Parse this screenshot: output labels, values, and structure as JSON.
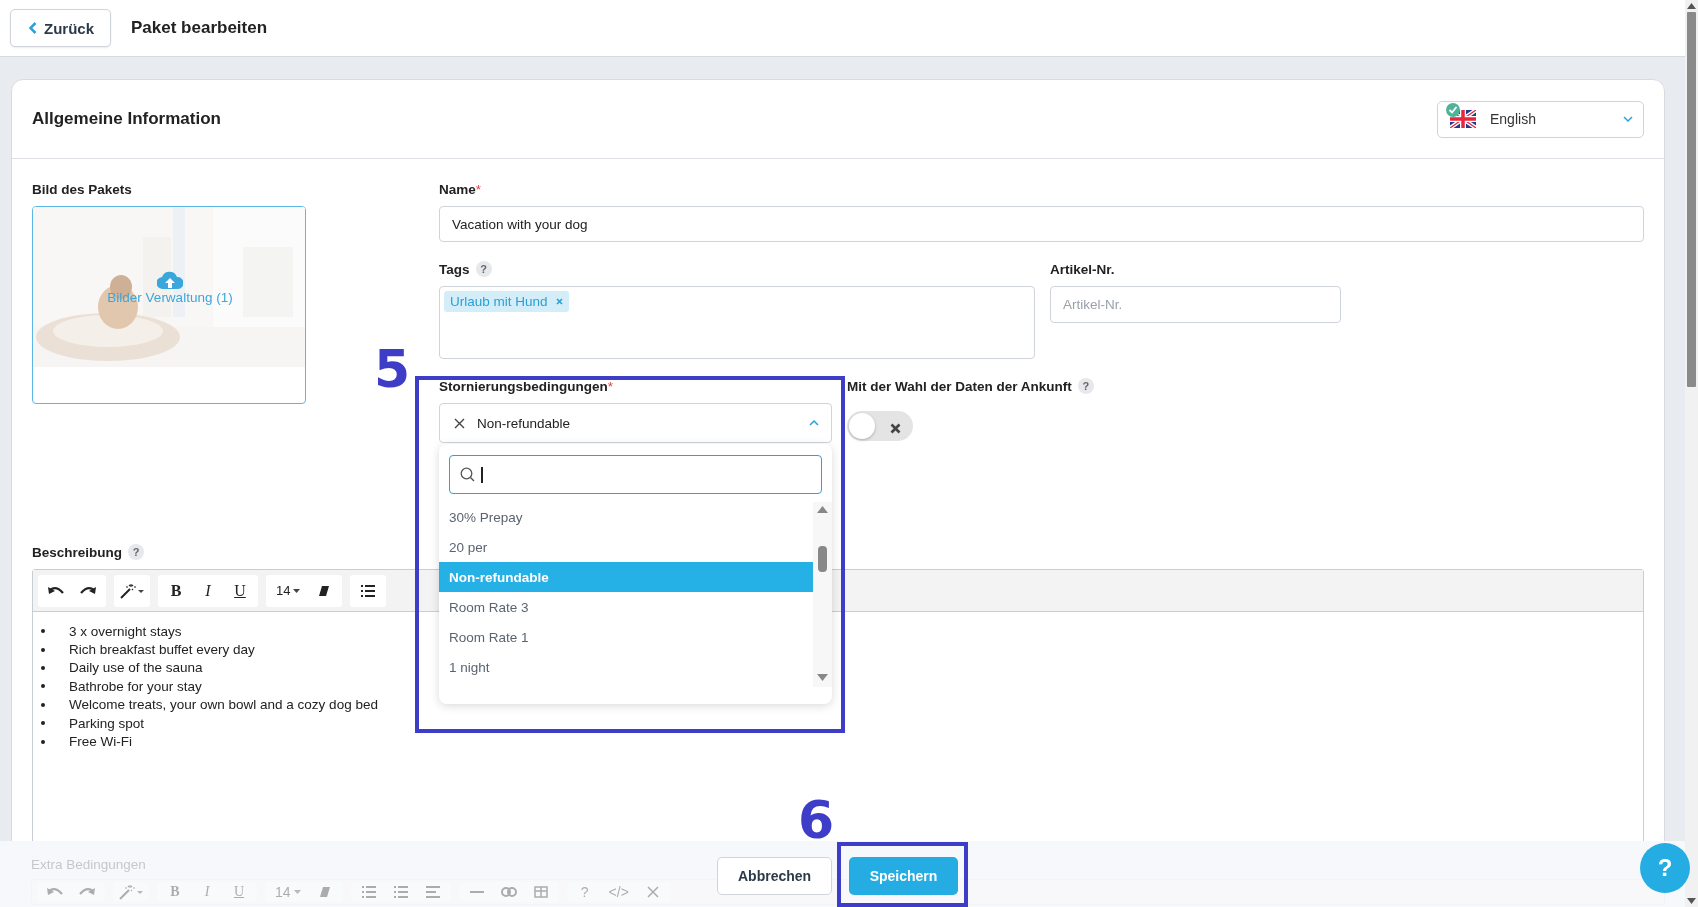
{
  "header": {
    "back_button": "Zurück",
    "title": "Paket bearbeiten"
  },
  "card": {
    "title": "Allgemeine Information",
    "language": {
      "value": "English"
    }
  },
  "image": {
    "label": "Bild des Pakets",
    "caption": "Bilder Verwaltung (1)"
  },
  "name": {
    "label": "Name",
    "required_mark": "*",
    "value": "Vacation with your dog"
  },
  "tags": {
    "label": "Tags",
    "help": "?",
    "items": [
      "Urlaub mit Hund"
    ]
  },
  "article": {
    "label": "Artikel-Nr.",
    "placeholder": "Artikel-Nr."
  },
  "cancellation": {
    "label": "Stornierungsbedingungen",
    "required_mark": "*",
    "value": "Non-refundable",
    "expanded": true,
    "options": [
      {
        "label": "30% Prepay",
        "selected": false
      },
      {
        "label": "20 per",
        "selected": false
      },
      {
        "label": "Non-refundable",
        "selected": true
      },
      {
        "label": "Room Rate 3",
        "selected": false
      },
      {
        "label": "Room Rate 1",
        "selected": false
      },
      {
        "label": "1 night",
        "selected": false
      }
    ]
  },
  "arrival_toggle": {
    "label": "Mit der Wahl der Daten der Ankunft",
    "help": "?",
    "on": false
  },
  "description": {
    "label": "Beschreibung",
    "help": "?",
    "toolbar": {
      "format_buttons": [
        "B",
        "I",
        "U"
      ],
      "font_size": "14"
    },
    "items": [
      "3 x overnight stays",
      "Rich breakfast buffet every day",
      "Daily use of the sauna",
      "Bathrobe for your stay",
      "Welcome treats, your own bowl and a cozy dog bed",
      "Parking spot",
      "Free Wi-Fi"
    ]
  },
  "extra": {
    "label": "Extra Bedingungen",
    "toolbar": {
      "format_buttons": [
        "B",
        "I",
        "U"
      ],
      "font_size": "14",
      "help": "?",
      "code": "</>"
    }
  },
  "buttons": [
    {
      "label": "Abbrechen",
      "kind": "secondary"
    },
    {
      "label": "Speichern",
      "kind": "primary"
    }
  ],
  "help_button": "?",
  "annotations": [
    {
      "label": "5"
    },
    {
      "label": "6"
    }
  ]
}
